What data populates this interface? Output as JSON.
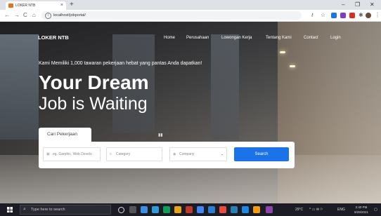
{
  "browser": {
    "tab_title": "LOKER NTB",
    "tab_close": "×",
    "new_tab": "+",
    "url": "localhost/jobportal/",
    "window_controls": {
      "minimize": "–",
      "restore": "❐",
      "close": "✕"
    }
  },
  "site": {
    "brand": "LOKER NTB",
    "menu": [
      "Home",
      "Perusahaan",
      "Lowongan Kerja",
      "Tentang Kami",
      "Contact",
      "Login"
    ],
    "tagline": "Kami Memiliki 1,000 tawaran pekerjaan hebat yang pantas Anda dapatkan!",
    "headline_1": "Your Dream",
    "headline_2": "Job is Waiting",
    "search": {
      "tab_label": "Cari Pekerjaan",
      "keyword_placeholder": "eg. Garphic. Web Develo",
      "category_placeholder": "Category",
      "company_placeholder": "Company",
      "button_label": "Search"
    }
  },
  "taskbar": {
    "search_placeholder": "Type here to search",
    "weather": "29°C",
    "time": "2:40 PM",
    "date": "9/29/2021",
    "lang": "ENG"
  }
}
